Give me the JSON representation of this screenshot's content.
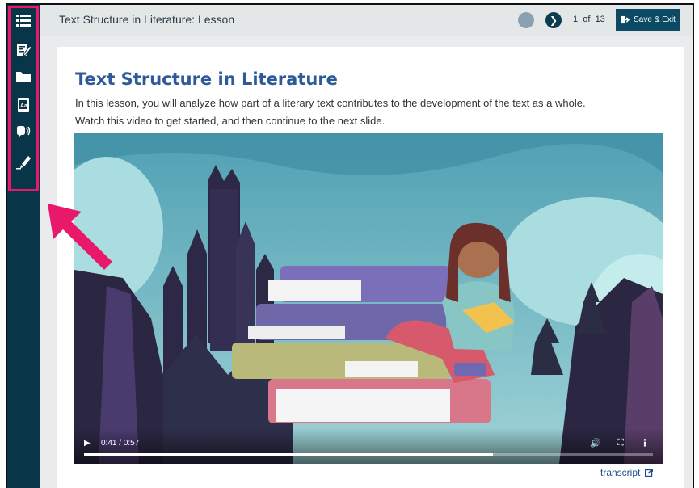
{
  "header": {
    "lesson_title": "Text Structure in Literature: Lesson",
    "current_page": "1",
    "of_label": "of",
    "total_pages": "13",
    "save_label": "Save & Exit"
  },
  "sidebar": {
    "tools": [
      {
        "icon": "list-icon"
      },
      {
        "icon": "notes-icon"
      },
      {
        "icon": "folder-icon"
      },
      {
        "icon": "dictionary-icon"
      },
      {
        "icon": "text-to-speech-icon"
      },
      {
        "icon": "highlighter-icon"
      }
    ],
    "highlight_color": "#e8196b"
  },
  "content": {
    "heading": "Text Structure in Literature",
    "intro_line1": "In this lesson, you will analyze how part of a literary text contributes to the development of the text as a whole.",
    "intro_line2": "Watch this video to get started, and then continue to the next slide."
  },
  "video": {
    "time": "0:41 / 0:57",
    "progress": 0.719
  },
  "transcript_label": "transcript",
  "colors": {
    "sidebar": "#083547",
    "heading": "#2d5b9a",
    "accent": "#0b4a62",
    "callout": "#e8196b"
  }
}
